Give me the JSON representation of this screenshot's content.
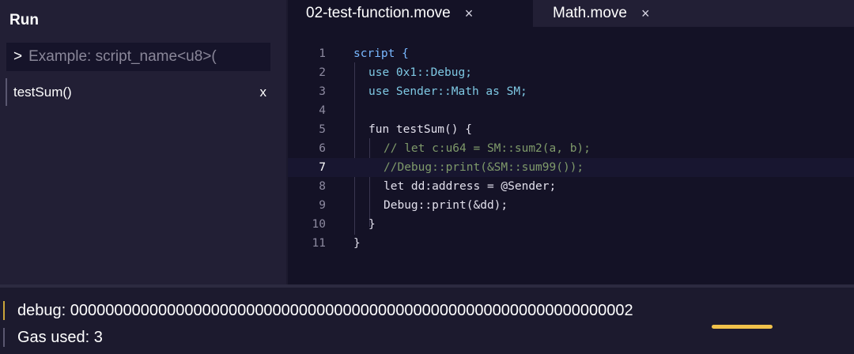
{
  "sidebar": {
    "title": "Run",
    "run_input": {
      "prompt": ">",
      "placeholder": "Example: script_name<u8>("
    },
    "scripts": [
      {
        "label": "testSum()",
        "remove": "x"
      }
    ]
  },
  "tabs": [
    {
      "label": "02-test-function.move",
      "close": "×"
    },
    {
      "label": "Math.move",
      "close": "×"
    }
  ],
  "editor": {
    "current_line": 7,
    "lines": [
      {
        "n": "1",
        "text": "script {"
      },
      {
        "n": "2",
        "text": "use 0x1::Debug;"
      },
      {
        "n": "3",
        "text": "use Sender::Math as SM;"
      },
      {
        "n": "4",
        "text": ""
      },
      {
        "n": "5",
        "text": "fun testSum() {"
      },
      {
        "n": "6",
        "text": "// let c:u64 = SM::sum2(a, b);"
      },
      {
        "n": "7",
        "text": "//Debug::print(&SM::sum99());"
      },
      {
        "n": "8",
        "text": "let dd:address = @Sender;"
      },
      {
        "n": "9",
        "text": "Debug::print(&dd);"
      },
      {
        "n": "10",
        "text": "}"
      },
      {
        "n": "11",
        "text": "}"
      }
    ]
  },
  "output": {
    "debug": "debug: 0000000000000000000000000000000000000000000000000000000000000002",
    "gas": "Gas used: 3"
  },
  "colors": {
    "accent_underline": "#f0c14b",
    "background": "#1c1a2e"
  }
}
